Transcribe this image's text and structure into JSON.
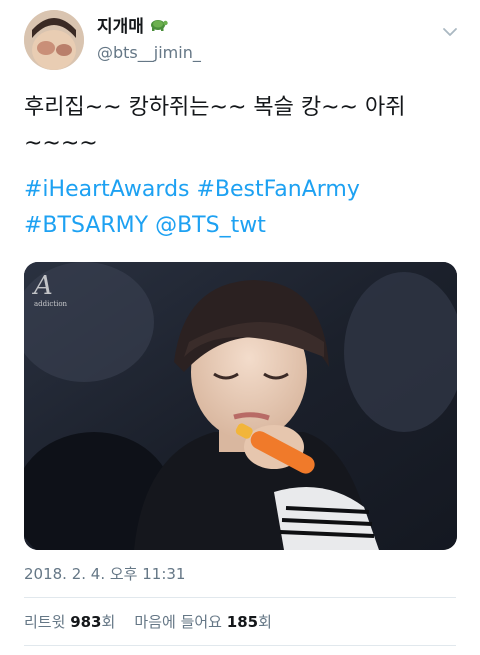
{
  "author": {
    "display_name": "지개매",
    "badge_icon": "turtle-icon",
    "handle": "@bts__jimin_"
  },
  "tweet": {
    "text_line1": "후리집~~ 캉하쥐는~~ 복슬 캉~~ 아쥐",
    "text_line2": "~~~~",
    "hashtags_line1": [
      "#iHeartAwards",
      "#BestFanArmy"
    ],
    "hashtags_line2": [
      "#BTSARMY",
      "@BTS_twt"
    ],
    "timestamp": "2018. 2. 4. 오후 11:31"
  },
  "media": {
    "watermark": "A addiction"
  },
  "stats": {
    "retweet_label": "리트윗",
    "retweet_count": "983",
    "retweet_suffix": "회",
    "like_label": "마음에 들어요",
    "like_count": "185",
    "like_suffix": "회"
  },
  "colors": {
    "link": "#1da1f2",
    "secondary_text": "#657786",
    "primary_text": "#14171a",
    "divider": "#e1e8ed"
  }
}
